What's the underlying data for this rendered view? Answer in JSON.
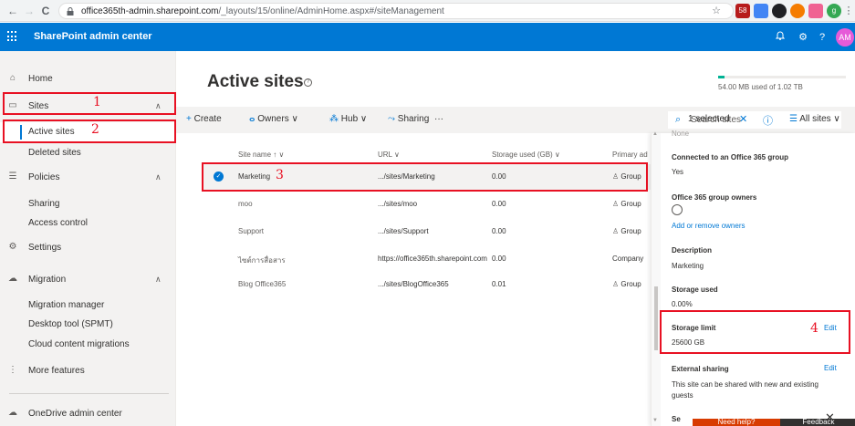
{
  "browser": {
    "url_host": "office365th-admin.sharepoint.com",
    "url_path": "/_layouts/15/online/AdminHome.aspx#/siteManagement",
    "back_glyph": "←",
    "forward_glyph": "→",
    "reload_glyph": "C",
    "ext_badge": "58",
    "profile_letter": "g"
  },
  "suite": {
    "title": "SharePoint admin center",
    "avatar": "AM",
    "bell_glyph": "🔔",
    "gear_glyph": "⚙",
    "help_glyph": "?"
  },
  "nav": {
    "home": "Home",
    "sites": "Sites",
    "active_sites": "Active sites",
    "deleted_sites": "Deleted sites",
    "policies": "Policies",
    "sharing": "Sharing",
    "access_control": "Access control",
    "settings": "Settings",
    "migration": "Migration",
    "migration_manager": "Migration manager",
    "desktop_tool": "Desktop tool (SPMT)",
    "cloud_migrations": "Cloud content migrations",
    "more_features": "More features",
    "onedrive": "OneDrive admin center",
    "chevron": "∧"
  },
  "annotations": {
    "n1": "1",
    "n2": "2",
    "n3": "3",
    "n4": "4"
  },
  "main": {
    "title": "Active sites",
    "storage_text": "54.00 MB used of 1.02 TB",
    "storage_fraction": 0.05
  },
  "commands": {
    "create": "Create",
    "owners": "Owners",
    "hub": "Hub",
    "sharing": "Sharing",
    "more": "···",
    "search_placeholder": "Search sites",
    "selected": "1 selected",
    "close": "✕",
    "info": "ⓘ",
    "view": "All sites"
  },
  "table": {
    "headers": [
      "Site name ↑",
      "URL",
      "Storage used (GB)",
      "Primary ad"
    ],
    "rows": [
      {
        "name": "Marketing",
        "url": ".../sites/Marketing",
        "storage": "0.00",
        "primary": "Group",
        "selected": true
      },
      {
        "name": "moo",
        "url": ".../sites/moo",
        "storage": "0.00",
        "primary": "Group"
      },
      {
        "name": "Support",
        "url": ".../sites/Support",
        "storage": "0.00",
        "primary": "Group"
      },
      {
        "name": "ไซต์การสื่อสาร",
        "url": "https://office365th.sharepoint.com",
        "storage": "0.00",
        "primary": "Company"
      },
      {
        "name": "Blog Office365",
        "url": ".../sites/BlogOffice365",
        "storage": "0.01",
        "primary": "Group"
      }
    ]
  },
  "panel": {
    "top_cut": "None",
    "connected_label": "Connected to an Office 365 group",
    "connected_value": "Yes",
    "owners_label": "Office 365 group owners",
    "owners_link": "Add or remove owners",
    "description_label": "Description",
    "description_value": "Marketing",
    "storage_used_label": "Storage used",
    "storage_used_value": "0.00%",
    "storage_limit_label": "Storage limit",
    "storage_limit_value": "25600 GB",
    "edit": "Edit",
    "external_label": "External sharing",
    "external_value_1": "This site can be shared with new and existing",
    "external_value_2": "guests",
    "bottom_cut": "Se",
    "need_help": "Need help?",
    "feedback": "Feedback"
  }
}
